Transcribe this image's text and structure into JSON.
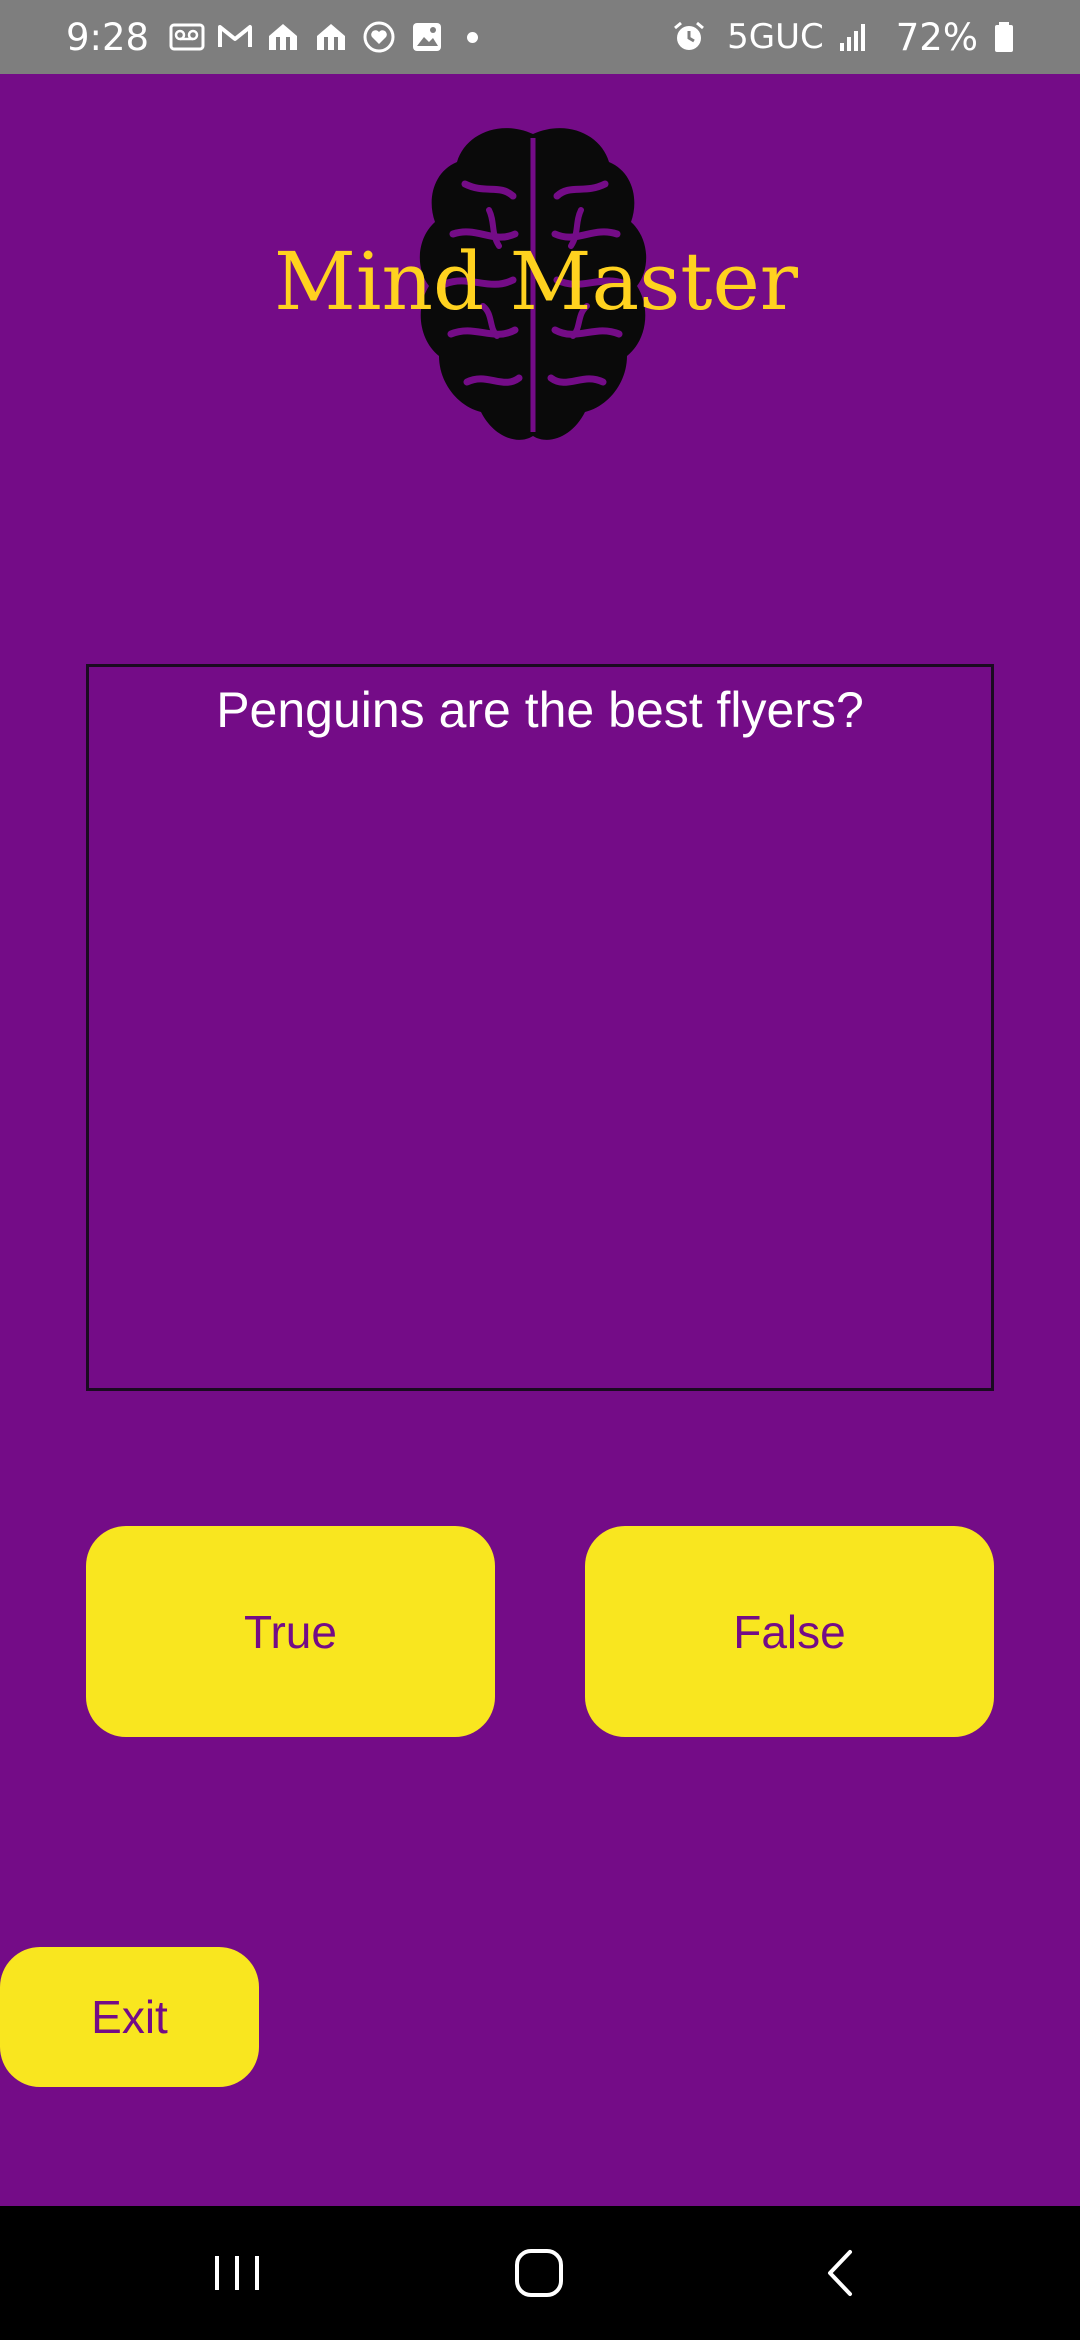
{
  "status_bar": {
    "time": "9:28",
    "network": "5GUC",
    "battery": "72%",
    "icons": [
      "voicemail-icon",
      "gmail-icon",
      "home-app-icon",
      "home-app-icon",
      "heart-app-icon",
      "gallery-icon",
      "notification-dot",
      "alarm-icon",
      "signal-icon",
      "battery-icon"
    ]
  },
  "app": {
    "title": "Mind Master",
    "logo_icon": "brain-icon",
    "question": "Penguins are the best flyers?",
    "true_label": "True",
    "false_label": "False",
    "exit_label": "Exit"
  },
  "colors": {
    "background": "#740c87",
    "title": "#ffd21f",
    "button": "#f9e61f",
    "button_text": "#740c87",
    "status_bar": "#7e7e7e",
    "nav_bar": "#000000"
  },
  "nav_bar": {
    "buttons": [
      "recent-apps-icon",
      "home-icon",
      "back-icon"
    ]
  }
}
